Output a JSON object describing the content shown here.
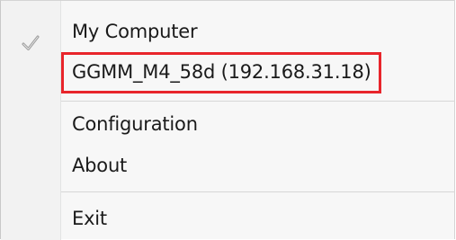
{
  "menu": {
    "items": [
      {
        "label": "My Computer",
        "checked": true
      },
      {
        "label": "GGMM_M4_58d (192.168.31.18)",
        "highlighted": true
      },
      {
        "label": "Configuration"
      },
      {
        "label": "About"
      },
      {
        "label": "Exit"
      }
    ]
  },
  "icons": {
    "check": "check-icon"
  },
  "colors": {
    "highlight_border": "#e8252b",
    "menu_background": "#f7f7f7",
    "check_icon": "#9b9b9b"
  }
}
